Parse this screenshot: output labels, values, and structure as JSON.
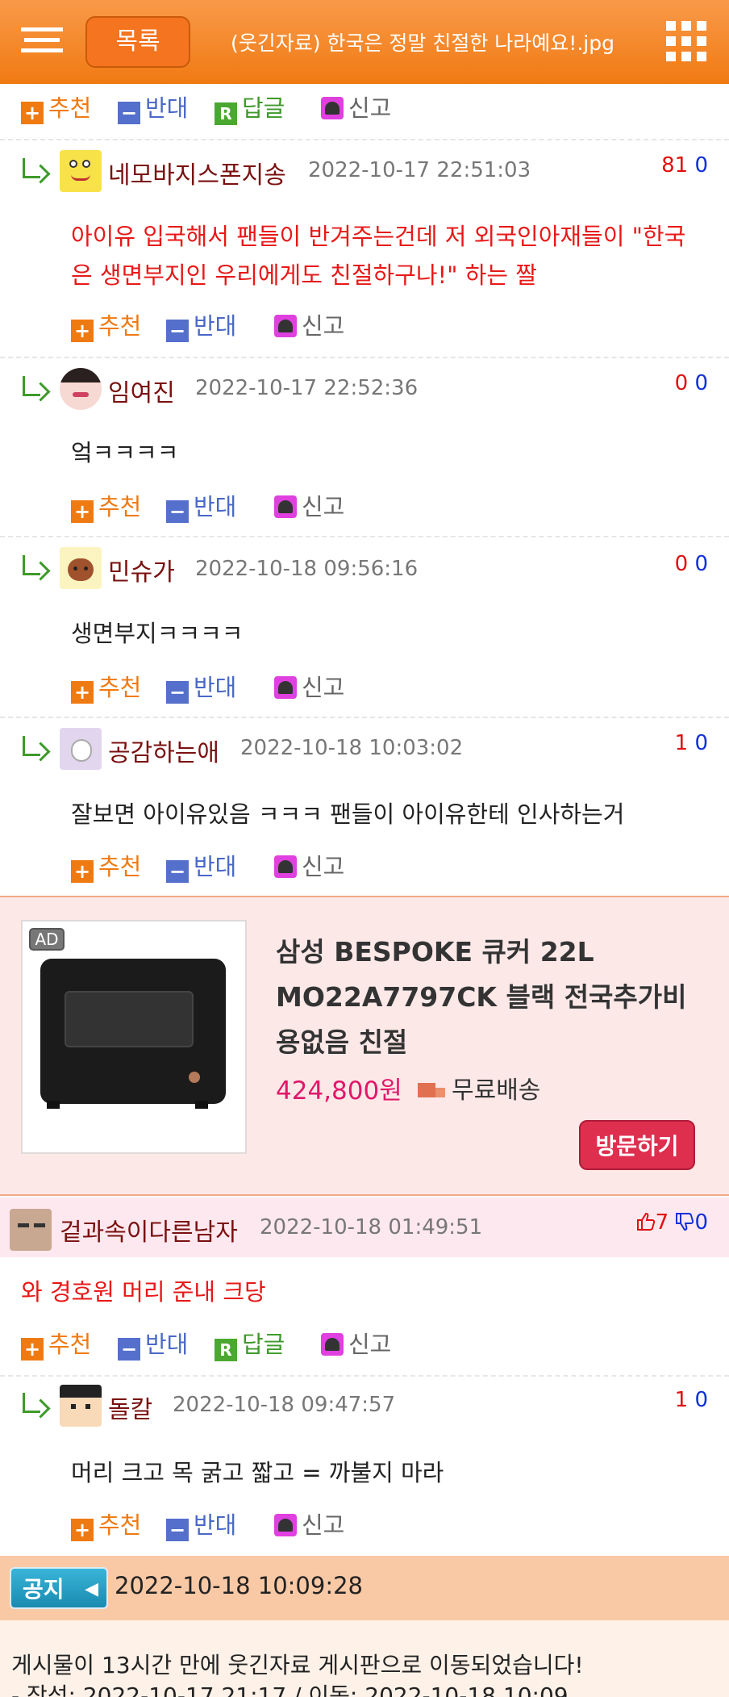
{
  "header": {
    "list_label": "목록",
    "title": "(웃긴자료) 한국은 정말 친절한 나라예요!.jpg"
  },
  "actions": {
    "recommend": "추천",
    "oppose": "반대",
    "reply": "답글",
    "report": "신고",
    "plus_glyph": "+",
    "minus_glyph": "−",
    "reply_glyph": "R"
  },
  "comments": [
    {
      "nick": "네모바지스폰지송",
      "date": "2022-10-17 22:51:03",
      "up": "81",
      "down": "0",
      "text_line1": "아이유 입국해서 팬들이 반겨주는건데 저 외국인아재들이 \"한국",
      "text_line2": "은 생면부지인 우리에게도 친절하구나!\" 하는 짤"
    },
    {
      "nick": "임여진",
      "date": "2022-10-17 22:52:36",
      "up": "0",
      "down": "0",
      "text": "엌ㅋㅋㅋㅋ"
    },
    {
      "nick": "민슈가",
      "date": "2022-10-18 09:56:16",
      "up": "0",
      "down": "0",
      "text": "생면부지ㅋㅋㅋㅋ"
    },
    {
      "nick": "공감하는애",
      "date": "2022-10-18 10:03:02",
      "up": "1",
      "down": "0",
      "text": "잘보면 아이유있음 ㅋㅋㅋ 팬들이 아이유한테 인사하는거"
    }
  ],
  "ad": {
    "badge": "AD",
    "title": "삼성 BESPOKE 큐커 22L MO22A7797CK 블랙 전국추가비용없음 친절",
    "price": "424,800원",
    "shipping": "무료배송",
    "visit": "방문하기"
  },
  "comment2": {
    "nick": "겉과속이다른남자",
    "date": "2022-10-18 01:49:51",
    "up": "7",
    "down": "0",
    "text": "와 경호원 머리 준내 크당"
  },
  "reply2": {
    "nick": "돌칼",
    "date": "2022-10-18 09:47:57",
    "up": "1",
    "down": "0",
    "text": "머리 크고 목 굵고 짧고 = 까불지 마라"
  },
  "notice": {
    "badge": "공지",
    "date": "2022-10-18 10:09:28",
    "line1": "게시물이 13시간 만에 웃긴자료 게시판으로 이동되었습니다!",
    "line2": "- 작성: 2022-10-17 21:17 / 이동: 2022-10-18 10:09"
  }
}
